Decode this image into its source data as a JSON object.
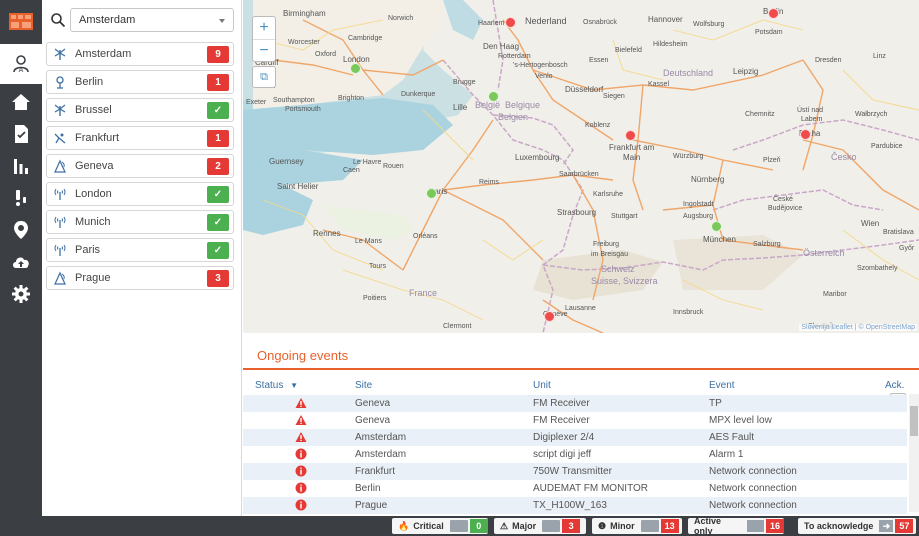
{
  "search": {
    "selected": "Amsterdam"
  },
  "sites": [
    {
      "name": "Amsterdam",
      "count": "9",
      "status": "red",
      "icon": "transmitter-icon"
    },
    {
      "name": "Berlin",
      "count": "1",
      "status": "red",
      "icon": "antenna-icon"
    },
    {
      "name": "Brussel",
      "count": "✓",
      "status": "green",
      "icon": "transmitter-icon"
    },
    {
      "name": "Frankfurt",
      "count": "1",
      "status": "red",
      "icon": "satellite-icon"
    },
    {
      "name": "Geneva",
      "count": "2",
      "status": "red",
      "icon": "signal-tower-icon"
    },
    {
      "name": "London",
      "count": "✓",
      "status": "green",
      "icon": "radio-tower-icon"
    },
    {
      "name": "Munich",
      "count": "✓",
      "status": "green",
      "icon": "radio-tower-icon"
    },
    {
      "name": "Paris",
      "count": "✓",
      "status": "green",
      "icon": "radio-tower-icon"
    },
    {
      "name": "Prague",
      "count": "3",
      "status": "red",
      "icon": "signal-tower-icon"
    }
  ],
  "map": {
    "zoom_in": "+",
    "zoom_out": "−",
    "fullscreen": "⧉",
    "attribution": "Slovenija Leaflet | © OpenStreetMap",
    "city_labels": [
      "Birmingham",
      "Norwich",
      "Cambridge",
      "Oxford",
      "London",
      "Bath",
      "Brighton",
      "Cardiff",
      "Southampton",
      "Portsmouth",
      "Exeter",
      "Haarlem",
      "Nederland",
      "Den Haag",
      "Rotterdam",
      "'s-Hertogenbosch",
      "Venlo",
      "Essen",
      "Osnabrück",
      "Hannover",
      "Wolfsburg",
      "Berlin",
      "Potsdam",
      "Bielefeld",
      "Hildesheim",
      "Deutschland",
      "Leipzig",
      "Dresden",
      "Kassel",
      "Düsseldorf",
      "Siegen",
      "Brugge",
      "Dunkerque",
      "Lille",
      "België",
      "Belgique",
      "Belgien",
      "Koblenz",
      "Frankfurt am Main",
      "Chemnitz",
      "Praha",
      "Česko",
      "Pardubice",
      "Würzburg",
      "Nürnberg",
      "Plzeň",
      "Luxembourg",
      "Saarbrücken",
      "Karlsruhe",
      "Strasbourg",
      "Stuttgart",
      "Ingolstadt",
      "Augsburg",
      "München",
      "České Budějovice",
      "Wien",
      "Österreich",
      "Salzburg",
      "Bratislava",
      "Guernsey",
      "Saint Helier",
      "Le Havre",
      "Rouen",
      "Caen",
      "Paris",
      "Reims",
      "Rennes",
      "Le Mans",
      "Orléans",
      "Tours",
      "Freiburg im Breisgau",
      "Schweiz",
      "Suisse",
      "Svizzera",
      "Lausanne",
      "Genève",
      "Poitiers",
      "France",
      "Clermont",
      "Maribor",
      "Szombathely",
      "Győr",
      "Ústí nad Labem",
      "Wałbrzych",
      "Linz",
      "Innsbruck"
    ],
    "markers": [
      {
        "site": "Amsterdam",
        "status": "red"
      },
      {
        "site": "Berlin",
        "status": "red"
      },
      {
        "site": "London",
        "status": "green"
      },
      {
        "site": "Brussel",
        "status": "green"
      },
      {
        "site": "Frankfurt",
        "status": "red"
      },
      {
        "site": "Prague",
        "status": "red"
      },
      {
        "site": "Paris",
        "status": "green"
      },
      {
        "site": "Munich",
        "status": "green"
      },
      {
        "site": "Geneva",
        "status": "red"
      }
    ]
  },
  "events": {
    "title": "Ongoing events",
    "headers": {
      "status": "Status",
      "site": "Site",
      "unit": "Unit",
      "event": "Event",
      "ack": "Ack."
    },
    "rows": [
      {
        "status": "critical",
        "site": "Geneva",
        "unit": "FM Receiver",
        "event": "TP"
      },
      {
        "status": "critical",
        "site": "Geneva",
        "unit": "FM Receiver",
        "event": "MPX level low"
      },
      {
        "status": "critical",
        "site": "Amsterdam",
        "unit": "Digiplexer 2/4",
        "event": "AES Fault"
      },
      {
        "status": "minor",
        "site": "Amsterdam",
        "unit": "script digi jeff",
        "event": "Alarm 1"
      },
      {
        "status": "minor",
        "site": "Frankfurt",
        "unit": "750W Transmitter",
        "event": "Network connection"
      },
      {
        "status": "minor",
        "site": "Berlin",
        "unit": "AUDEMAT FM MONITOR",
        "event": "Network connection"
      },
      {
        "status": "minor",
        "site": "Prague",
        "unit": "TX_H100W_163",
        "event": "Network connection"
      }
    ]
  },
  "bottombar": {
    "critical_label": "Critical",
    "critical_count": "0",
    "major_label": "Major",
    "major_count": "3",
    "minor_label": "Minor",
    "minor_count": "13",
    "active_label": "Active only",
    "active_count": "16",
    "ack_label": "To acknowledge",
    "ack_count": "57"
  },
  "colors": {
    "accent": "#e8612c",
    "nav": "#3b3f44",
    "critical": "#e53935",
    "ok": "#4caf50",
    "header_text": "#3d6fa5"
  }
}
